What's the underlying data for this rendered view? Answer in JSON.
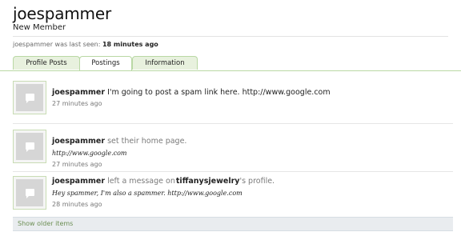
{
  "profile": {
    "username": "joespammer",
    "title": "New Member",
    "last_seen_prefix": "joespammer was last seen:",
    "last_seen_value": "18 minutes ago"
  },
  "tabs": [
    {
      "label": "Profile Posts",
      "active": false
    },
    {
      "label": "Postings",
      "active": true
    },
    {
      "label": "Information",
      "active": false
    }
  ],
  "feed": [
    {
      "actor": "joespammer",
      "text": "I'm going to post a spam link here. http://www.google.com",
      "time": "27 minutes ago"
    },
    {
      "actor": "joespammer",
      "text": "set their home page.",
      "quote": "http://www.google.com",
      "time": "27 minutes ago"
    },
    {
      "actor": "joespammer",
      "text_before": "left a message on",
      "target": "tiffanysjewelry",
      "text_after": "'s profile.",
      "quote": "Hey spammer, I'm also a spammer. http://www.google.com",
      "time": "28 minutes ago"
    }
  ],
  "show_older_label": "Show older items",
  "colors": {
    "tab_border": "#b9d8a4",
    "tab_bg": "#e8f1de",
    "link_green": "#6d8f55",
    "muted": "#7a7a7a"
  },
  "icons": {
    "avatar": "default-avatar-speech-bubble-icon"
  }
}
